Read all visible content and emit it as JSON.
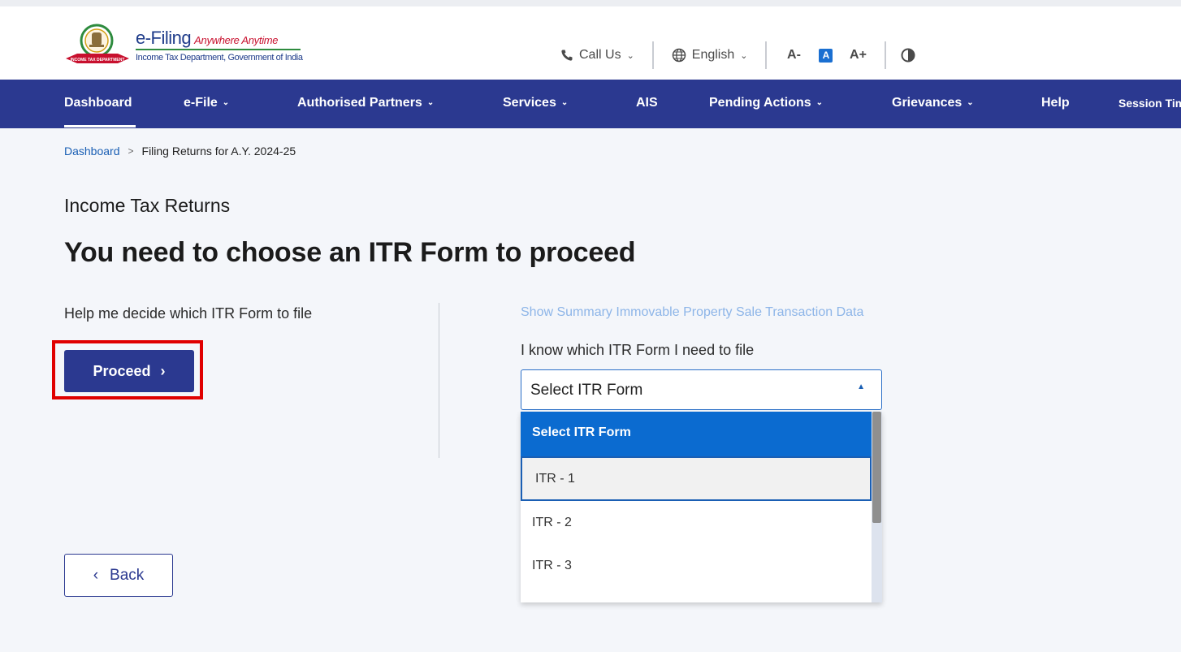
{
  "header": {
    "brand_name": "e-Filing",
    "brand_tagline": "Anywhere Anytime",
    "brand_subtitle": "Income Tax Department, Government of India",
    "emblem_ribbon_text": "INCOME TAX DEPARTMENT",
    "call_us_label": "Call Us",
    "language_label": "English",
    "font_decrease_label": "A-",
    "font_default_label": "A",
    "font_increase_label": "A+",
    "contrast_icon": "contrast-icon"
  },
  "nav": {
    "items": [
      {
        "label": "Dashboard",
        "caret": ""
      },
      {
        "label": "e-File",
        "caret": "⌄"
      },
      {
        "label": "Authorised Partners",
        "caret": "⌄"
      },
      {
        "label": "Services",
        "caret": "⌄"
      },
      {
        "label": "AIS",
        "caret": ""
      },
      {
        "label": "Pending Actions",
        "caret": "⌄"
      },
      {
        "label": "Grievances",
        "caret": "⌄"
      },
      {
        "label": "Help",
        "caret": ""
      },
      {
        "label": "Session Tim",
        "caret": ""
      }
    ],
    "active": "Dashboard"
  },
  "breadcrumb": {
    "home": "Dashboard",
    "separator": ">",
    "current": "Filing Returns for A.Y. 2024-25"
  },
  "main": {
    "section_title": "Income Tax Returns",
    "heading": "You need to choose an ITR Form to proceed",
    "help_text": "Help me decide which ITR Form to file",
    "proceed_label": "Proceed",
    "proceed_icon": "›",
    "summary_link": "Show Summary Immovable Property Sale Transaction Data",
    "know_label": "I know which ITR Form I need to file",
    "select_value": "Select ITR Form",
    "select_arrow": "▲",
    "options": [
      "Select ITR Form",
      "ITR - 1",
      "ITR - 2",
      "ITR - 3"
    ],
    "back_label": "Back",
    "back_icon": "‹"
  },
  "colors": {
    "nav_bg": "#2b3990",
    "primary_button": "#2b3990",
    "dropdown_selected": "#0b6bd0",
    "highlight_box": "#e00000",
    "link": "#1a5fb4"
  }
}
